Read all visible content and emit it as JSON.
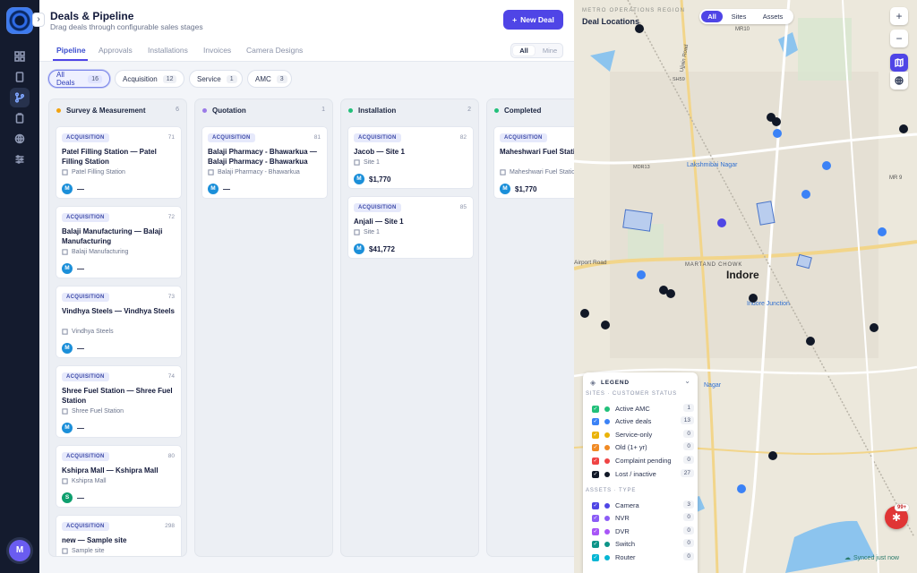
{
  "header": {
    "title": "Deals & Pipeline",
    "subtitle": "Drag deals through configurable sales stages",
    "new_deal": "New Deal"
  },
  "tabs": [
    "Pipeline",
    "Approvals",
    "Installations",
    "Invoices",
    "Camera Designs"
  ],
  "scope": {
    "all": "All",
    "mine": "Mine"
  },
  "filters": [
    {
      "label": "All Deals",
      "count": "16"
    },
    {
      "label": "Acquisition",
      "count": "12"
    },
    {
      "label": "Service",
      "count": "1"
    },
    {
      "label": "AMC",
      "count": "3"
    }
  ],
  "columns": [
    {
      "name": "Survey & Measurement",
      "count": "6",
      "color": "#f2a30f",
      "cards": [
        {
          "badge": "ACQUISITION",
          "num": "71",
          "title": "Patel Filling Station — Patel Filling Station",
          "sub": "Patel Filling Station",
          "avatar": "M",
          "value": "—"
        },
        {
          "badge": "ACQUISITION",
          "num": "72",
          "title": "Balaji Manufacturing — Balaji Manufacturing",
          "sub": "Balaji Manufacturing",
          "avatar": "M",
          "value": "—"
        },
        {
          "badge": "ACQUISITION",
          "num": "73",
          "title": "Vindhya Steels — Vindhya Steels",
          "sub": "Vindhya Steels",
          "avatar": "M",
          "value": "—"
        },
        {
          "badge": "ACQUISITION",
          "num": "74",
          "title": "Shree Fuel Station — Shree Fuel Station",
          "sub": "Shree Fuel Station",
          "avatar": "M",
          "value": "—"
        },
        {
          "badge": "ACQUISITION",
          "num": "80",
          "title": "Kshipra Mall — Kshipra Mall",
          "sub": "Kshipra Mall",
          "avatar": "S",
          "value": "—"
        },
        {
          "badge": "ACQUISITION",
          "num": "298",
          "title": "new — Sample site",
          "sub": "Sample site",
          "avatar": "",
          "value": ""
        }
      ]
    },
    {
      "name": "Quotation",
      "count": "1",
      "color": "#9b7be8",
      "cards": [
        {
          "badge": "ACQUISITION",
          "num": "81",
          "title": "Balaji Pharmacy - Bhawarkua — Balaji Pharmacy - Bhawarkua",
          "sub": "Balaji Pharmacy - Bhawarkua",
          "avatar": "M",
          "value": "—"
        }
      ]
    },
    {
      "name": "Installation",
      "count": "2",
      "color": "#22c07a",
      "cards": [
        {
          "badge": "ACQUISITION",
          "num": "82",
          "title": "Jacob — Site 1",
          "sub": "Site 1",
          "avatar": "M",
          "value": "$1,770"
        },
        {
          "badge": "ACQUISITION",
          "num": "85",
          "title": "Anjali — Site 1",
          "sub": "Site 1",
          "avatar": "M",
          "value": "$41,772"
        }
      ]
    },
    {
      "name": "Completed",
      "count": "",
      "color": "#22c07a",
      "cards": [
        {
          "badge": "ACQUISITION",
          "num": "",
          "title": "Maheshwari Fuel Station — Maheshwari Fuel Station",
          "sub": "Maheshwari Fuel Station",
          "avatar": "M",
          "value": "$1,770"
        }
      ]
    }
  ],
  "map": {
    "region": "METRO OPERATIONS REGION",
    "title": "Deal Locations",
    "toggle": [
      "All",
      "Sites",
      "Assets"
    ],
    "city": "Indore",
    "places": [
      "Lakshmibai Nagar",
      "MARTAND CHOWK",
      "Indore Junction",
      "Airport Road",
      "Ujjain Road",
      "MR10",
      "MR 9",
      "SH59",
      "MDR13",
      "Nagar"
    ],
    "legend_title": "LEGEND",
    "sites_title": "SITES · CUSTOMER STATUS",
    "sites": [
      {
        "label": "Active AMC",
        "count": "1",
        "color": "#22c07a"
      },
      {
        "label": "Active deals",
        "count": "13",
        "color": "#3b82f6"
      },
      {
        "label": "Service-only",
        "count": "0",
        "color": "#eab308"
      },
      {
        "label": "Old (1+ yr)",
        "count": "0",
        "color": "#f08a24"
      },
      {
        "label": "Complaint pending",
        "count": "0",
        "color": "#ef4444"
      },
      {
        "label": "Lost / inactive",
        "count": "27",
        "color": "#111827"
      }
    ],
    "assets_title": "ASSETS · TYPE",
    "assets": [
      {
        "label": "Camera",
        "count": "3",
        "color": "#4f46e5"
      },
      {
        "label": "NVR",
        "count": "0",
        "color": "#8b5cf6"
      },
      {
        "label": "DVR",
        "count": "0",
        "color": "#a855f7"
      },
      {
        "label": "Switch",
        "count": "0",
        "color": "#0d9488"
      },
      {
        "label": "Router",
        "count": "0",
        "color": "#06b6d4"
      }
    ],
    "synced": "Synced just now",
    "bug_count": "99+"
  },
  "user": {
    "initial": "M"
  }
}
